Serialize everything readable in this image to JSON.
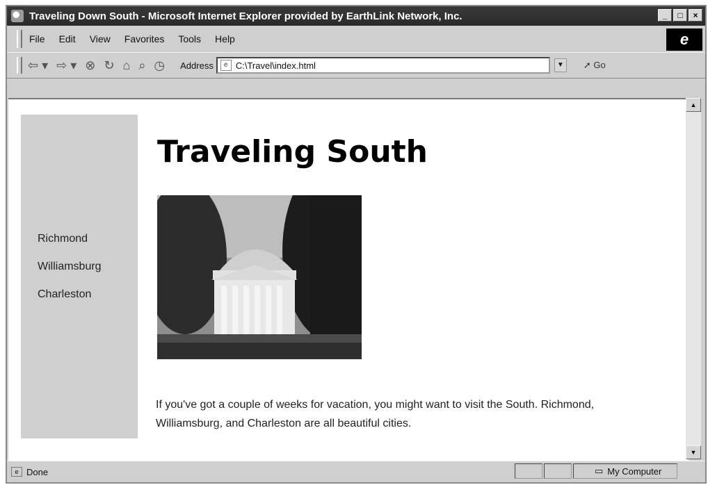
{
  "window": {
    "title": "Traveling Down South - Microsoft Internet Explorer provided by EarthLink Network, Inc.",
    "controls": [
      "_",
      "□",
      "×"
    ]
  },
  "menubar": {
    "items": [
      "File",
      "Edit",
      "View",
      "Favorites",
      "Tools",
      "Help"
    ]
  },
  "toolbar": {
    "address_label": "Address",
    "address_value": "C:\\Travel\\index.html",
    "go_label": "Go"
  },
  "sidebar": {
    "links": [
      "Richmond",
      "Williamsburg",
      "Charleston"
    ]
  },
  "main": {
    "title": "Traveling South",
    "intro": "If you've got a couple of weeks for vacation, you might want to visit the South. Richmond, Williamsburg, and Charleston are all beautiful cities."
  },
  "statusbar": {
    "status": "Done",
    "zone": "My Computer"
  }
}
